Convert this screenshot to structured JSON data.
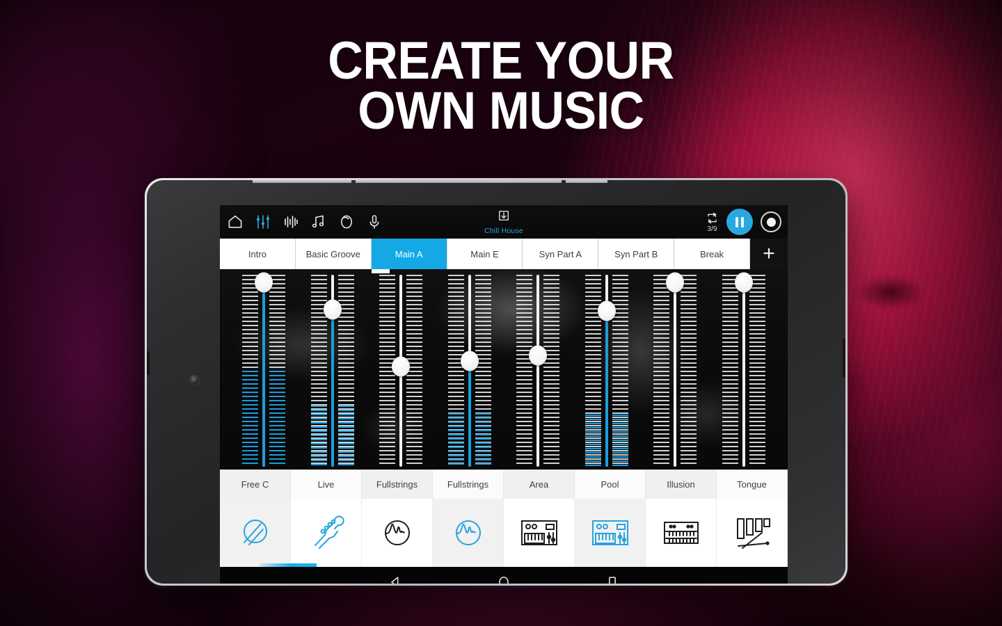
{
  "headline": {
    "line1": "CREATE YOUR",
    "line2": "OWN MUSIC"
  },
  "colors": {
    "accent_blue": "#14a9e6",
    "fader_blue": "#1b9ddd",
    "tab_active_bg": "#14a9e6",
    "toolbar_bg": "#0e0e0e",
    "white": "#ffffff",
    "bg_magenta": "#d6154f"
  },
  "device": {
    "type": "android-tablet",
    "orientation": "landscape"
  },
  "app": {
    "toolbar": {
      "left_icons": [
        {
          "name": "home-icon",
          "label": "Home",
          "active": false
        },
        {
          "name": "mixer-icon",
          "label": "Mixer",
          "active": true
        },
        {
          "name": "waveform-icon",
          "label": "Waveform",
          "active": false
        },
        {
          "name": "music-notes-icon",
          "label": "Notes",
          "active": false
        },
        {
          "name": "loop-circle-icon",
          "label": "Loops",
          "active": false
        },
        {
          "name": "microphone-icon",
          "label": "Record Audio",
          "active": false
        }
      ],
      "project": {
        "icon": "save-download-icon",
        "name": "Chill House"
      },
      "right": {
        "loop_icon": "loop-repeat-icon",
        "loop_count": "3/9",
        "play_button": {
          "name": "pause-button",
          "state": "pause"
        },
        "record_button": {
          "name": "record-button",
          "state": "idle"
        }
      }
    },
    "section_tabs": {
      "items": [
        {
          "label": "Intro",
          "active": false
        },
        {
          "label": "Basic Groove",
          "active": false
        },
        {
          "label": "Main A",
          "active": true
        },
        {
          "label": "Main E",
          "active": false
        },
        {
          "label": "Syn Part A",
          "active": false
        },
        {
          "label": "Syn Part B",
          "active": false
        },
        {
          "label": "Break",
          "active": false
        }
      ],
      "add_label": "+"
    },
    "mixer": {
      "tracks": [
        {
          "name": "Free C",
          "icon": "cymbal-drum-icon",
          "icon_color": "blue",
          "icon_shade": true,
          "name_shade": true,
          "knob_pct": 4,
          "blue_rail": true,
          "blue_ticks_from_pct": 50
        },
        {
          "name": "Live",
          "icon": "guitar-neck-icon",
          "icon_color": "blue",
          "icon_shade": false,
          "name_shade": false,
          "knob_pct": 18,
          "blue_rail": true,
          "blue_ticks_from_pct": 68
        },
        {
          "name": "Fullstrings",
          "icon": "waveform-circle-icon",
          "icon_color": "black",
          "icon_shade": false,
          "name_shade": true,
          "knob_pct": 48,
          "blue_rail": false,
          "blue_ticks_from_pct": 0
        },
        {
          "name": "Fullstrings",
          "icon": "waveform-circle-icon",
          "icon_color": "blue",
          "icon_shade": true,
          "name_shade": false,
          "knob_pct": 45,
          "blue_rail": true,
          "blue_ticks_from_pct": 72
        },
        {
          "name": "Area",
          "icon": "synth-keyboard-icon",
          "icon_color": "black",
          "icon_shade": false,
          "name_shade": true,
          "knob_pct": 42,
          "blue_rail": false,
          "blue_ticks_from_pct": 0
        },
        {
          "name": "Pool",
          "icon": "synth-keyboard-icon",
          "icon_color": "blue",
          "icon_shade": true,
          "name_shade": false,
          "knob_pct": 19,
          "blue_rail": true,
          "blue_ticks_from_pct": 73
        },
        {
          "name": "Illusion",
          "icon": "organ-keys-icon",
          "icon_color": "black",
          "icon_shade": false,
          "name_shade": true,
          "knob_pct": 4,
          "blue_rail": false,
          "blue_ticks_from_pct": 0
        },
        {
          "name": "Tongue",
          "icon": "mallet-bars-icon",
          "icon_color": "black",
          "icon_shade": false,
          "name_shade": false,
          "knob_pct": 4,
          "blue_rail": false,
          "blue_ticks_from_pct": 0
        }
      ]
    },
    "scrollbar": {
      "name": "horizontal-scrollbar",
      "position_pct": 7,
      "width_pct": 10
    }
  },
  "system_nav": {
    "back": "back-button",
    "home": "home-button",
    "recents": "recents-button"
  }
}
